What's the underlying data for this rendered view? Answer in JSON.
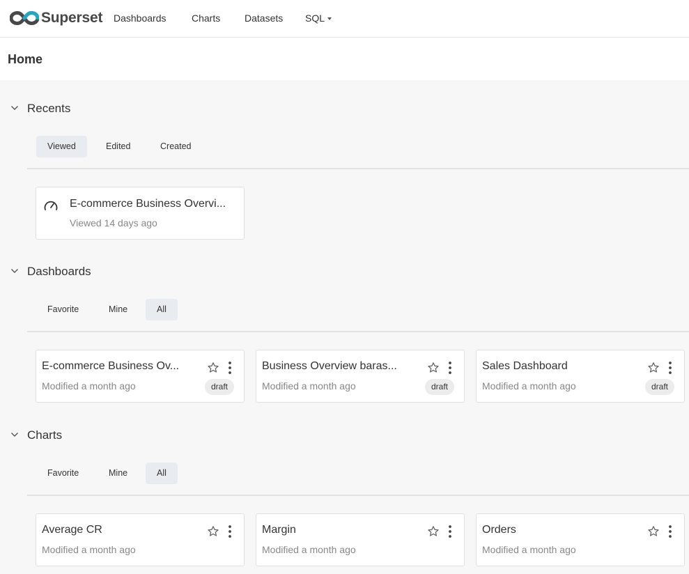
{
  "brand": {
    "name": "Superset"
  },
  "nav": {
    "items": [
      {
        "label": "Dashboards"
      },
      {
        "label": "Charts"
      },
      {
        "label": "Datasets"
      },
      {
        "label": "SQL"
      }
    ]
  },
  "page": {
    "title": "Home"
  },
  "recents": {
    "title": "Recents",
    "tabs": [
      {
        "label": "Viewed",
        "active": true
      },
      {
        "label": "Edited",
        "active": false
      },
      {
        "label": "Created",
        "active": false
      }
    ],
    "items": [
      {
        "title": "E-commerce Business Overvi...",
        "subtitle": "Viewed 14 days ago"
      }
    ]
  },
  "dashboards": {
    "title": "Dashboards",
    "tabs": [
      {
        "label": "Favorite",
        "active": false
      },
      {
        "label": "Mine",
        "active": false
      },
      {
        "label": "All",
        "active": true
      }
    ],
    "items": [
      {
        "title": "E-commerce Business Ov...",
        "subtitle": "Modified a month ago",
        "badge": "draft"
      },
      {
        "title": "Business Overview baras...",
        "subtitle": "Modified a month ago",
        "badge": "draft"
      },
      {
        "title": "Sales Dashboard",
        "subtitle": "Modified a month ago",
        "badge": "draft"
      }
    ]
  },
  "charts": {
    "title": "Charts",
    "tabs": [
      {
        "label": "Favorite",
        "active": false
      },
      {
        "label": "Mine",
        "active": false
      },
      {
        "label": "All",
        "active": true
      }
    ],
    "items": [
      {
        "title": "Average CR",
        "subtitle": "Modified a month ago"
      },
      {
        "title": "Margin",
        "subtitle": "Modified a month ago"
      },
      {
        "title": "Orders",
        "subtitle": "Modified a month ago"
      }
    ]
  },
  "colors": {
    "logo_dark": "#484848",
    "logo_accent": "#20a7c9",
    "active_tab_bg": "#e8ebef",
    "card_border": "#e0e0e0",
    "page_bg": "#f7f7f7"
  },
  "icons": {
    "logo": "superset-logo-icon",
    "section_toggle": "chevron-down-icon",
    "favorite": "star-icon",
    "more": "more-vertical-icon",
    "recent_dashboard": "dashboard-gauge-icon"
  }
}
